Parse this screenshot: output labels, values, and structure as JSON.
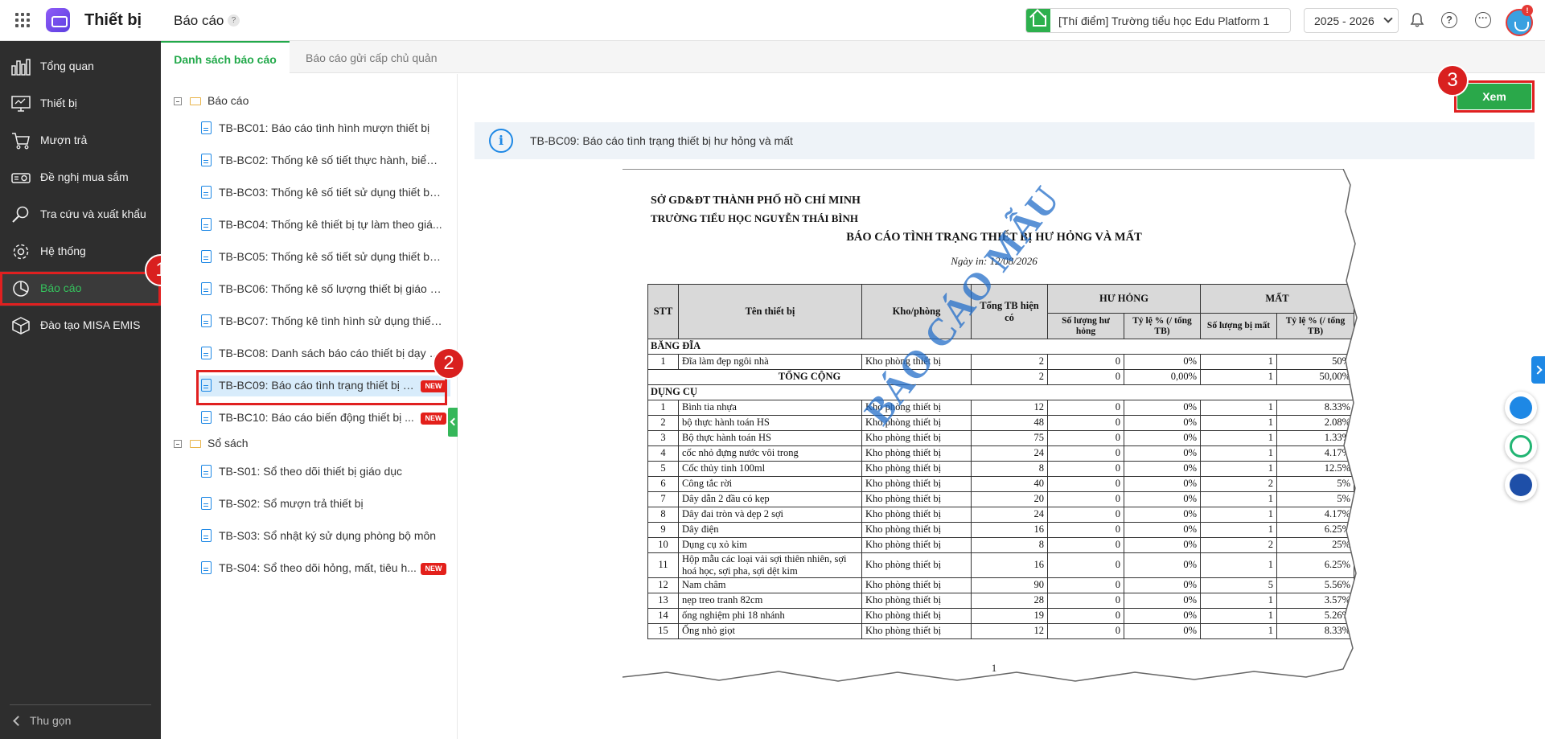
{
  "topbar": {
    "app_title": "Thiết bị",
    "page_title": "Báo cáo",
    "help_mark": "?",
    "school": "[Thí điểm] Trường tiểu học Edu Platform 1",
    "year": "2025 - 2026",
    "notification_count": "!"
  },
  "sidebar": {
    "items": [
      {
        "label": "Tổng quan",
        "icon": "chart-icon"
      },
      {
        "label": "Thiết bị",
        "icon": "monitor-icon"
      },
      {
        "label": "Mượn trả",
        "icon": "cart-icon"
      },
      {
        "label": "Đề nghị mua sắm",
        "icon": "projector-icon"
      },
      {
        "label": "Tra cứu và xuất khẩu",
        "icon": "search-icon"
      },
      {
        "label": "Hệ thống",
        "icon": "gear-icon"
      },
      {
        "label": "Báo cáo",
        "icon": "pie-chart-icon"
      },
      {
        "label": "Đào tạo MISA EMIS",
        "icon": "cube-icon"
      }
    ],
    "collapse_label": "Thu gọn"
  },
  "steps": [
    "1",
    "2",
    "3"
  ],
  "tabs": {
    "active": "Danh sách báo cáo",
    "inactive": "Báo cáo gửi cấp chủ quản"
  },
  "tree": {
    "folder1": "Báo cáo",
    "reports": [
      "TB-BC01: Báo cáo tình hình mượn thiết bị",
      "TB-BC02: Thống kê số tiết thực hành, biểu ...",
      "TB-BC03: Thống kê số tiết sử dụng thiết bị,...",
      "TB-BC04: Thống kê thiết bị tự làm theo giá...",
      "TB-BC05: Thống kê số tiết sử dụng thiết bị ...",
      "TB-BC06: Thống kê số lượng thiết bị giáo d...",
      "TB-BC07: Thống kê tình hình sử dụng thiết ...",
      "TB-BC08: Danh sách báo cáo thiết bị dạy h...",
      "TB-BC09: Báo cáo tình trạng thiết bị h...",
      "TB-BC10: Báo cáo biến động thiết bị ..."
    ],
    "folder2": "Sổ sách",
    "books": [
      "TB-S01: Sổ theo dõi thiết bị giáo dục",
      "TB-S02: Sổ mượn trả thiết bị",
      "TB-S03: Sổ nhật ký sử dụng phòng bộ môn",
      "TB-S04: Sổ theo dõi hỏng, mất, tiêu h..."
    ],
    "new_badge": "NEW"
  },
  "main": {
    "view_button": "Xem",
    "info_text": "TB-BC09: Báo cáo tình trạng thiết bị hư hỏng và mất"
  },
  "report": {
    "org1": "SỞ GD&ĐT THÀNH PHỐ HỒ CHÍ MINH",
    "org2": "TRƯỜNG TIỂU HỌC NGUYỄN THÁI BÌNH",
    "title": "BÁO CÁO TÌNH TRẠNG THIẾT BỊ HƯ HỎNG VÀ MẤT",
    "date": "Ngày in: 12/08/2026",
    "watermark": "BÁO CÁO MẪU",
    "page_number": "1",
    "headers": {
      "stt": "STT",
      "name": "Tên thiết bị",
      "room": "Kho/phòng",
      "total": "Tổng TB hiện có",
      "damaged": "HƯ HỎNG",
      "lost": "MẤT",
      "damaged_qty": "Số lượng hư hỏng",
      "damaged_pct": "Tỷ lệ % (/ tổng TB)",
      "lost_qty": "Số lượng bị mất",
      "lost_pct": "Tỷ lệ % (/ tổng TB)"
    },
    "group1": {
      "name": "BĂNG ĐĨA",
      "rows": [
        [
          "1",
          "Đĩa làm đẹp ngôi nhà",
          "Kho phòng thiết bị",
          "2",
          "0",
          "0%",
          "1",
          "50%"
        ]
      ],
      "total": [
        "TỔNG CỘNG",
        "2",
        "0",
        "0,00%",
        "1",
        "50,00%"
      ]
    },
    "group2": {
      "name": "DỤNG CỤ",
      "rows": [
        [
          "1",
          "Bình tia nhựa",
          "Kho phòng thiết bị",
          "12",
          "0",
          "0%",
          "1",
          "8.33%"
        ],
        [
          "2",
          "bộ thực hành toán HS",
          "Kho phòng thiết bị",
          "48",
          "0",
          "0%",
          "1",
          "2.08%"
        ],
        [
          "3",
          "Bộ thực hành toán HS",
          "Kho phòng thiết bị",
          "75",
          "0",
          "0%",
          "1",
          "1.33%"
        ],
        [
          "4",
          "cốc nhỏ đựng nước vôi trong",
          "Kho phòng thiết bị",
          "24",
          "0",
          "0%",
          "1",
          "4.17%"
        ],
        [
          "5",
          "Cốc thủy tinh 100ml",
          "Kho phòng thiết bị",
          "8",
          "0",
          "0%",
          "1",
          "12.5%"
        ],
        [
          "6",
          "Công tắc rời",
          "Kho phòng thiết bị",
          "40",
          "0",
          "0%",
          "2",
          "5%"
        ],
        [
          "7",
          "Dây dẫn 2 đầu có kẹp",
          "Kho phòng thiết bị",
          "20",
          "0",
          "0%",
          "1",
          "5%"
        ],
        [
          "8",
          "Dây đai tròn và dẹp 2 sợi",
          "Kho phòng thiết bị",
          "24",
          "0",
          "0%",
          "1",
          "4.17%"
        ],
        [
          "9",
          "Dây điện",
          "Kho phòng thiết bị",
          "16",
          "0",
          "0%",
          "1",
          "6.25%"
        ],
        [
          "10",
          "Dụng cụ xỏ kim",
          "Kho phòng thiết bị",
          "8",
          "0",
          "0%",
          "2",
          "25%"
        ],
        [
          "11",
          "Hộp mẫu các loại vải sợi thiên nhiên, sợi hoá học, sợi pha, sợi dệt kim",
          "Kho phòng thiết bị",
          "16",
          "0",
          "0%",
          "1",
          "6.25%"
        ],
        [
          "12",
          "Nam châm",
          "Kho phòng thiết bị",
          "90",
          "0",
          "0%",
          "5",
          "5.56%"
        ],
        [
          "13",
          "nẹp treo tranh 82cm",
          "Kho phòng thiết bị",
          "28",
          "0",
          "0%",
          "1",
          "3.57%"
        ],
        [
          "14",
          "ống nghiệm phi 18 nhánh",
          "Kho phòng thiết bị",
          "19",
          "0",
          "0%",
          "1",
          "5.26%"
        ],
        [
          "15",
          "Ống nhỏ giọt",
          "Kho phòng thiết bị",
          "12",
          "0",
          "0%",
          "1",
          "8.33%"
        ]
      ]
    }
  },
  "colors": {
    "brand_green": "#2aa84a",
    "sidebar_bg": "#2e2e2e",
    "highlight_red": "#e02020",
    "accent_blue": "#1e88e5"
  }
}
